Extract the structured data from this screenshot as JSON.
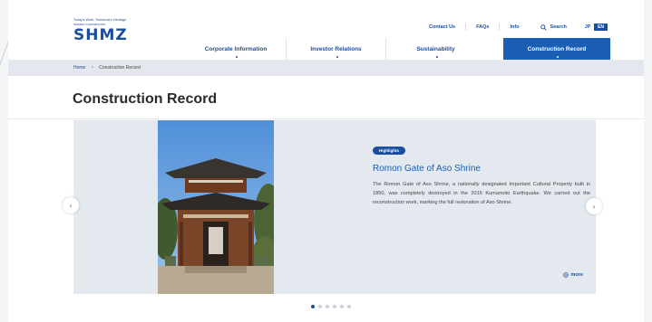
{
  "logo": {
    "tagline": "Today's Work, Tomorrow's Heritage",
    "sub": "SHIMIZU CORPORATION",
    "name": "SHMZ"
  },
  "utility_nav": {
    "contact": "Contact Us",
    "faqs": "FAQs",
    "info": "Info",
    "search": "Search",
    "lang_jp": "JP",
    "lang_en": "EN"
  },
  "global_nav": [
    {
      "label": "Corporate Information"
    },
    {
      "label": "Investor Relations"
    },
    {
      "label": "Sustainability"
    },
    {
      "label": "Construction Record"
    }
  ],
  "breadcrumb": {
    "home": "Home",
    "separator": ">",
    "current": "Construction Record"
  },
  "page_title": "Construction Record",
  "slide": {
    "badge": "Highlights",
    "heading": "Romon Gate of Aso Shrine",
    "description": "The Romon Gate of Aso Shrine, a nationally designated Important Cultural Property built in 1850, was completely destroyed in the 2016 Kumamoto Earthquake. We carried out the reconstruction work, marking the full restoration of Aso Shrine.",
    "more": "more"
  },
  "carousel": {
    "total_slides": 6,
    "active_index": 0,
    "prev_icon": "‹",
    "next_icon": "›"
  },
  "colors": {
    "brand": "#1a4ea0",
    "active_nav": "#1a5fb4",
    "breadcrumb_bg": "#e4e8ee",
    "slide_bg": "#e4e9f0"
  }
}
